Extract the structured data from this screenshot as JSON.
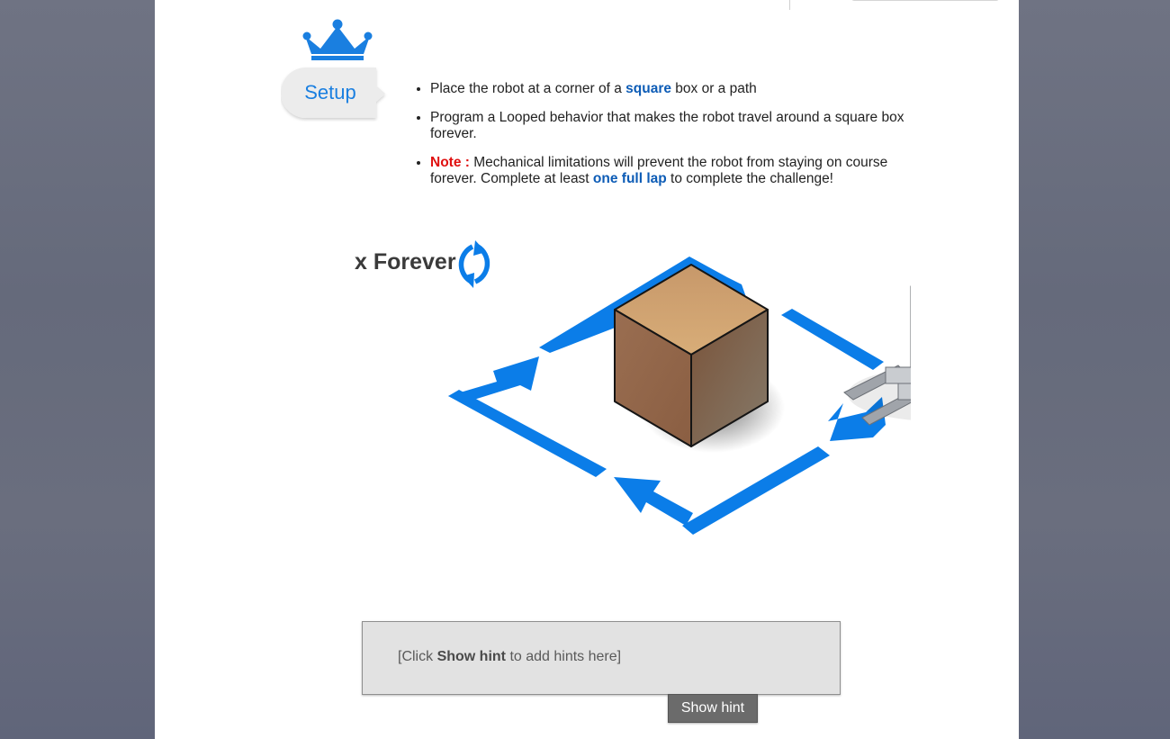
{
  "setup": {
    "title": "Setup",
    "bullets": {
      "b1": {
        "pre": "Place the robot at a corner of a ",
        "em": "square",
        "post": " box or a path"
      },
      "b2": {
        "text": "Program a Looped behavior that makes the robot travel around a square box forever."
      },
      "b3": {
        "note": "Note :",
        "pre": " Mechanical limitations will prevent the robot from staying on course forever. Complete at least ",
        "em": "one full lap",
        "post": " to complete the challenge!"
      }
    }
  },
  "illustration": {
    "loop_label": "x Forever"
  },
  "hint": {
    "pre": "[Click ",
    "bold": "Show hint",
    "post": " to add hints here]",
    "button_label": "Show hint"
  },
  "colors": {
    "accent_blue": "#1a7fe0",
    "note_red": "#e01010",
    "arrow_blue": "#0b7de8"
  }
}
